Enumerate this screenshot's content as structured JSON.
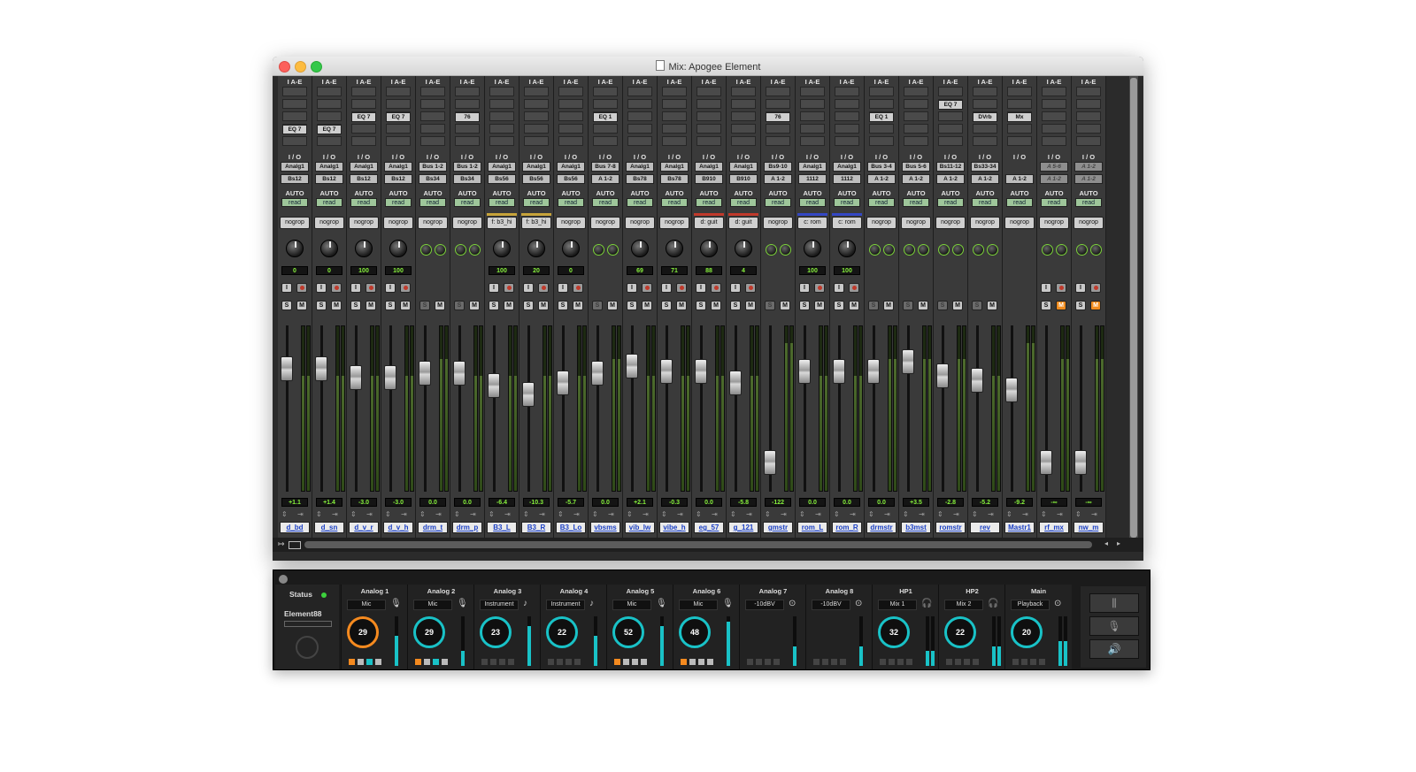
{
  "window": {
    "title": "Mix: Apogee Element"
  },
  "labels": {
    "insert": "I A-E",
    "io": "I / O",
    "auto": "AUTO"
  },
  "strips": [
    {
      "name": "d_bd",
      "insert": "EQ 7",
      "in": "Analg1",
      "out": "Bs12",
      "auto": "read",
      "group": "nogrop",
      "pan": "0",
      "hasRec": true,
      "solo": "S",
      "mute": "M",
      "vol": "+1.1",
      "fader": 0.78,
      "meter": 0.7
    },
    {
      "name": "d_sn",
      "insert": "EQ 7",
      "in": "Analg1",
      "out": "Bs12",
      "auto": "read",
      "group": "nogrop",
      "pan": "0",
      "hasRec": true,
      "solo": "S",
      "mute": "M",
      "vol": "+1.4",
      "fader": 0.78,
      "meter": 0.7
    },
    {
      "name": "d_v_r",
      "insert": "EQ 7",
      "in": "Analg1",
      "out": "Bs12",
      "auto": "read",
      "group": "nogrop",
      "pan": "100",
      "hasRec": true,
      "solo": "S",
      "mute": "M",
      "vol": "-3.0",
      "fader": 0.72,
      "meter": 0.7
    },
    {
      "name": "d_v_h",
      "insert": "EQ 7",
      "in": "Analg1",
      "out": "Bs12",
      "auto": "read",
      "group": "nogrop",
      "pan": "100",
      "hasRec": true,
      "solo": "S",
      "mute": "M",
      "vol": "-3.0",
      "fader": 0.72,
      "meter": 0.7
    },
    {
      "name": "drm_t",
      "insert": "",
      "in": "Bus 1-2",
      "out": "Bs34",
      "auto": "read",
      "group": "nogrop",
      "pan": "",
      "hasRec": false,
      "solo": "S",
      "mute": "M",
      "vol": "0.0",
      "fader": 0.75,
      "meter": 0.8
    },
    {
      "name": "drm_p",
      "insert": "76",
      "in": "Bus 1-2",
      "out": "Bs34",
      "auto": "read",
      "group": "nogrop",
      "pan": "",
      "hasRec": false,
      "solo": "S",
      "mute": "M",
      "vol": "0.0",
      "fader": 0.75,
      "meter": 0.7
    },
    {
      "name": "B3_L",
      "insert": "",
      "in": "Analg1",
      "out": "Bs56",
      "auto": "read",
      "group": "f: b3_hi",
      "pan": "100",
      "hasRec": true,
      "solo": "S",
      "mute": "M",
      "vol": "-6.4",
      "fader": 0.66,
      "meter": 0.7
    },
    {
      "name": "B3_R",
      "insert": "",
      "in": "Analg1",
      "out": "Bs56",
      "auto": "read",
      "group": "f: b3_hi",
      "pan": "20",
      "hasRec": true,
      "solo": "S",
      "mute": "M",
      "vol": "-10.3",
      "fader": 0.6,
      "meter": 0.7
    },
    {
      "name": "B3_Lo",
      "insert": "",
      "in": "Analg1",
      "out": "Bs56",
      "auto": "read",
      "group": "nogrop",
      "pan": "0",
      "hasRec": true,
      "solo": "S",
      "mute": "M",
      "vol": "-5.7",
      "fader": 0.68,
      "meter": 0.7
    },
    {
      "name": "vbsms",
      "insert": "EQ 1",
      "in": "Bus 7-8",
      "out": "A 1-2",
      "auto": "read",
      "group": "nogrop",
      "pan": "",
      "hasRec": false,
      "solo": "S",
      "mute": "M",
      "vol": "0.0",
      "fader": 0.75,
      "meter": 0.8
    },
    {
      "name": "vib_lw",
      "insert": "",
      "in": "Analg1",
      "out": "Bs78",
      "auto": "read",
      "group": "nogrop",
      "pan": "69",
      "hasRec": true,
      "solo": "S",
      "mute": "M",
      "vol": "+2.1",
      "fader": 0.8,
      "meter": 0.7
    },
    {
      "name": "vibe_h",
      "insert": "",
      "in": "Analg1",
      "out": "Bs78",
      "auto": "read",
      "group": "nogrop",
      "pan": "71",
      "hasRec": true,
      "solo": "S",
      "mute": "M",
      "vol": "-0.3",
      "fader": 0.76,
      "meter": 0.7
    },
    {
      "name": "eg_57",
      "insert": "",
      "in": "Analg1",
      "out": "B910",
      "auto": "read",
      "group": "d: guit",
      "pan": "88",
      "hasRec": true,
      "solo": "S",
      "mute": "M",
      "vol": "0.0",
      "fader": 0.76,
      "meter": 0.7
    },
    {
      "name": "g_121",
      "insert": "",
      "in": "Analg1",
      "out": "B910",
      "auto": "read",
      "group": "d: guit",
      "pan": "4",
      "hasRec": true,
      "solo": "S",
      "mute": "M",
      "vol": "-5.8",
      "fader": 0.68,
      "meter": 0.7
    },
    {
      "name": "gmstr",
      "insert": "76",
      "in": "Bs9-10",
      "out": "A 1-2",
      "auto": "read",
      "group": "nogrop",
      "pan": "",
      "hasRec": false,
      "solo": "S",
      "mute": "M",
      "vol": "-122",
      "fader": 0.12,
      "meter": 0.9
    },
    {
      "name": "rom_L",
      "insert": "",
      "in": "Analg1",
      "out": "1112",
      "auto": "read",
      "group": "c: rom",
      "pan": "100",
      "hasRec": true,
      "solo": "S",
      "mute": "M",
      "vol": "0.0",
      "fader": 0.76,
      "meter": 0.7
    },
    {
      "name": "rom_R",
      "insert": "",
      "in": "Analg1",
      "out": "1112",
      "auto": "read",
      "group": "c: rom",
      "pan": "100",
      "hasRec": true,
      "solo": "S",
      "mute": "M",
      "vol": "0.0",
      "fader": 0.76,
      "meter": 0.7
    },
    {
      "name": "drmstr",
      "insert": "EQ 1",
      "in": "Bus 3-4",
      "out": "A 1-2",
      "auto": "read",
      "group": "nogrop",
      "pan": "",
      "hasRec": false,
      "solo": "S",
      "mute": "M",
      "vol": "0.0",
      "fader": 0.76,
      "meter": 0.8
    },
    {
      "name": "b3mst",
      "insert": "",
      "in": "Bus 5-6",
      "out": "A 1-2",
      "auto": "read",
      "group": "nogrop",
      "pan": "",
      "hasRec": false,
      "solo": "S",
      "mute": "M",
      "vol": "+3.5",
      "fader": 0.83,
      "meter": 0.8
    },
    {
      "name": "romstr",
      "insert": "EQ 7",
      "in": "Bs11-12",
      "out": "A 1-2",
      "auto": "read",
      "group": "nogrop",
      "pan": "",
      "hasRec": false,
      "solo": "S",
      "mute": "M",
      "vol": "-2.8",
      "fader": 0.73,
      "meter": 0.8
    },
    {
      "name": "rev",
      "insert": "DVrb",
      "in": "Bs33-34",
      "out": "A 1-2",
      "auto": "read",
      "group": "nogrop",
      "pan": "",
      "hasRec": false,
      "solo": "S",
      "mute": "M",
      "vol": "-5.2",
      "fader": 0.7,
      "meter": 0.7
    },
    {
      "name": "Mastr1",
      "insert": "Mx",
      "in": "",
      "out": "A 1-2",
      "auto": "read",
      "group": "nogrop",
      "pan": "",
      "hasRec": false,
      "solo": "",
      "mute": "",
      "vol": "-9.2",
      "fader": 0.63,
      "meter": 0.9
    },
    {
      "name": "rf_mx",
      "insert": "",
      "in": "A 5-6",
      "out": "A 1-2",
      "auto": "read",
      "group": "nogrop",
      "pan": "",
      "hasRec": true,
      "solo": "S",
      "mute": "M",
      "muteOn": true,
      "vol": "-∞",
      "fader": 0.12,
      "meter": 0.8
    },
    {
      "name": "nw_m",
      "insert": "",
      "in": "A 1-2",
      "out": "A 1-2",
      "auto": "read",
      "group": "nogrop",
      "pan": "",
      "hasRec": true,
      "solo": "S",
      "mute": "M",
      "muteOn": true,
      "vol": "-∞",
      "fader": 0.12,
      "meter": 0.8
    }
  ],
  "element": {
    "status": "Status",
    "device": "Element88",
    "channels": [
      {
        "name": "Analog 1",
        "mode": "Mic",
        "gain": "29",
        "ring": "orange",
        "meter": 0.6
      },
      {
        "name": "Analog 2",
        "mode": "Mic",
        "gain": "29",
        "ring": "cyan",
        "meter": 0.3
      },
      {
        "name": "Analog 3",
        "mode": "Instrument",
        "gain": "23",
        "ring": "cyan",
        "meter": 0.8
      },
      {
        "name": "Analog 4",
        "mode": "Instrument",
        "gain": "22",
        "ring": "cyan",
        "meter": 0.6
      },
      {
        "name": "Analog 5",
        "mode": "Mic",
        "gain": "52",
        "ring": "cyan",
        "meter": 0.8
      },
      {
        "name": "Analog 6",
        "mode": "Mic",
        "gain": "48",
        "ring": "cyan",
        "meter": 0.9
      },
      {
        "name": "Analog 7",
        "mode": "-10dBV",
        "gain": "",
        "ring": "",
        "meter": 0.4
      },
      {
        "name": "Analog 8",
        "mode": "-10dBV",
        "gain": "",
        "ring": "",
        "meter": 0.4
      },
      {
        "name": "HP1",
        "mode": "Mix 1",
        "gain": "32",
        "ring": "cyan",
        "meter": 0.3
      },
      {
        "name": "HP2",
        "mode": "Mix 2",
        "gain": "22",
        "ring": "cyan",
        "meter": 0.4
      },
      {
        "name": "Main",
        "mode": "Playback",
        "gain": "20",
        "ring": "cyan",
        "meter": 0.5
      }
    ]
  },
  "colors": {
    "accent_cyan": "#19c2c7",
    "accent_orange": "#f58a1f",
    "meter_green": "#86f03c"
  }
}
